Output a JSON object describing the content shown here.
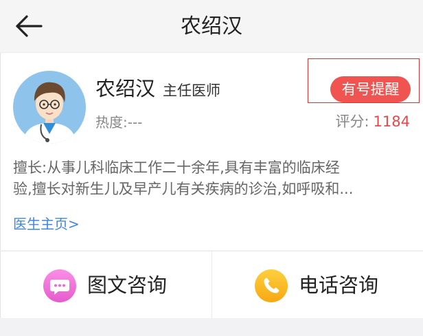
{
  "header": {
    "title": "农绍汉",
    "back_icon": "arrow-left-icon"
  },
  "doctor": {
    "name": "农绍汉",
    "title": "主任医师",
    "heat_label": "热度:",
    "heat_value": "---",
    "rating_label": "评分:",
    "rating_value": "1184",
    "remind_button": "有号提醒",
    "specialty_line1": "擅长:从事儿科临床工作二十余年,具有丰富的临床经",
    "specialty_line2": "验,擅长对新生儿及早产儿有关疾病的诊治,如呼吸和...",
    "home_link": "医生主页>",
    "avatar_icon": "doctor-avatar"
  },
  "consult": {
    "text_label": "图文咨询",
    "text_icon": "chat-bubble-icon",
    "phone_label": "电话咨询",
    "phone_icon": "phone-icon"
  },
  "colors": {
    "accent_red": "#ef5450",
    "rating_red": "#e8474a",
    "link_blue": "#3f86e0",
    "chat_pink": "#f06ad6",
    "phone_orange": "#f9b61a"
  }
}
